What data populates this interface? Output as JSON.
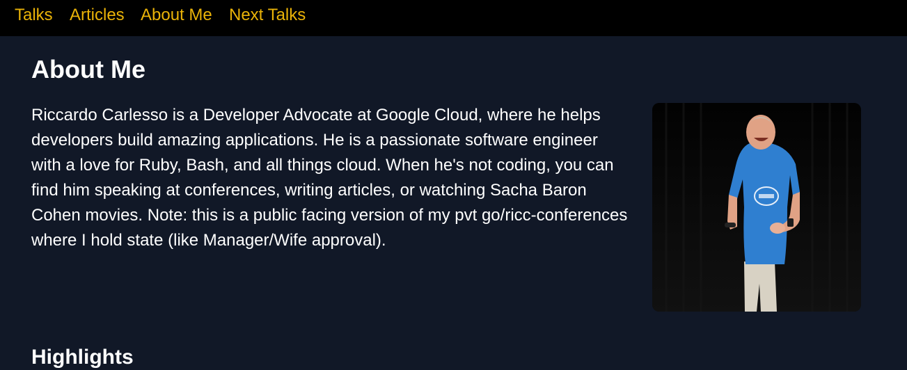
{
  "nav": {
    "items": [
      {
        "label": "Talks"
      },
      {
        "label": "Articles"
      },
      {
        "label": "About Me"
      },
      {
        "label": "Next Talks"
      }
    ]
  },
  "main": {
    "title": "About Me",
    "bio": "Riccardo Carlesso is a Developer Advocate at Google Cloud, where he helps developers build amazing applications. He is a passionate software engineer with a love for Ruby, Bash, and all things cloud. When he's not coding, you can find him speaking at conferences, writing articles, or watching Sacha Baron Cohen movies. Note: this is a public facing version of my pvt go/ricc-conferences where I hold state (like Manager/Wife approval).",
    "highlights_title": "Highlights"
  },
  "colors": {
    "background": "#111827",
    "nav_background": "#000000",
    "nav_link": "#eab308",
    "text": "#ffffff"
  }
}
